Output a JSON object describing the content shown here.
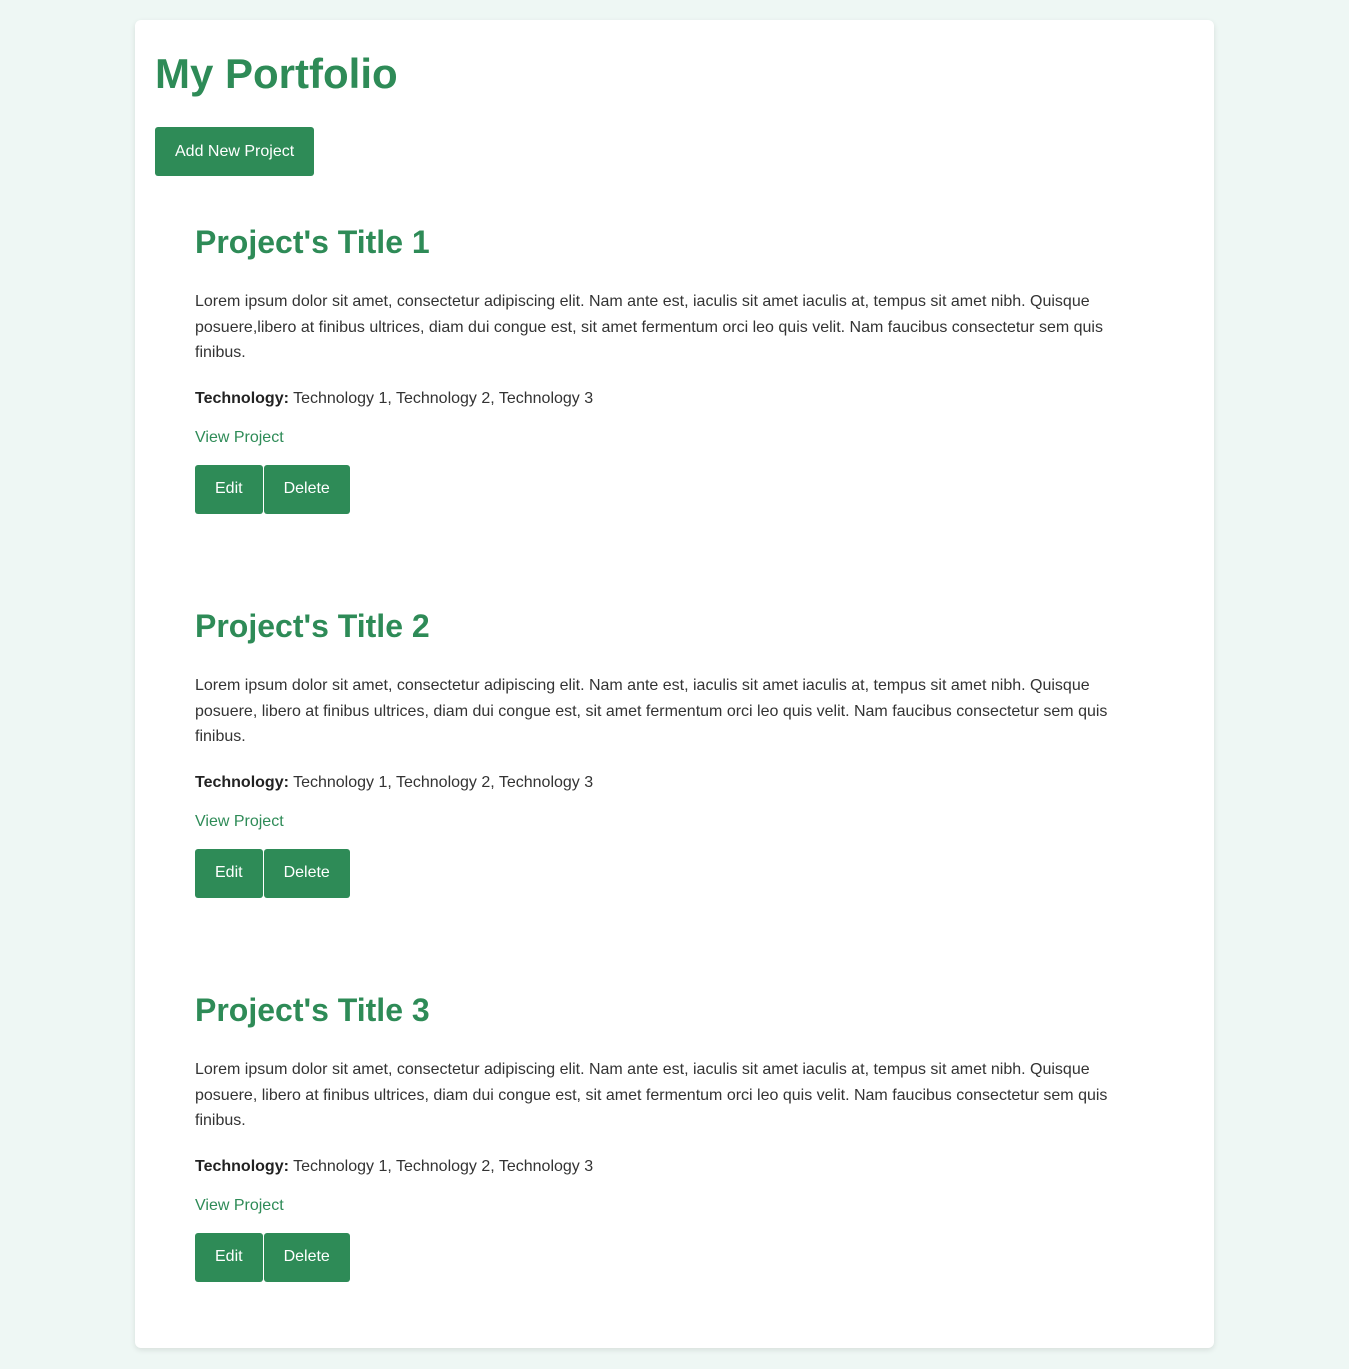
{
  "header": {
    "title": "My Portfolio",
    "add_button_label": "Add New Project"
  },
  "projects": [
    {
      "title": "Project's Title 1",
      "description": "Lorem ipsum dolor sit amet, consectetur adipiscing elit. Nam ante est, iaculis sit amet iaculis at, tempus sit amet nibh. Quisque posuere,libero at finibus ultrices, diam dui congue est, sit amet fermentum orci leo quis velit. Nam faucibus consectetur sem quis finibus.",
      "technology_label": "Technology:",
      "technologies": "Technology 1, Technology 2, Technology 3",
      "view_label": "View Project",
      "edit_label": "Edit",
      "delete_label": "Delete"
    },
    {
      "title": "Project's Title 2",
      "description": "Lorem ipsum dolor sit amet, consectetur adipiscing elit. Nam ante est, iaculis sit amet iaculis at, tempus sit amet nibh. Quisque posuere, libero at finibus ultrices, diam dui congue est, sit amet fermentum orci leo quis velit. Nam faucibus consectetur sem quis finibus.",
      "technology_label": "Technology:",
      "technologies": "Technology 1, Technology 2, Technology 3",
      "view_label": "View Project",
      "edit_label": "Edit",
      "delete_label": "Delete"
    },
    {
      "title": "Project's Title 3",
      "description": "Lorem ipsum dolor sit amet, consectetur adipiscing elit. Nam ante est, iaculis sit amet iaculis at, tempus sit amet nibh. Quisque posuere, libero at finibus ultrices, diam dui congue est, sit amet fermentum orci leo quis velit. Nam faucibus consectetur sem quis finibus.",
      "technology_label": "Technology:",
      "technologies": "Technology 1, Technology 2, Technology 3",
      "view_label": "View Project",
      "edit_label": "Edit",
      "delete_label": "Delete"
    }
  ],
  "colors": {
    "accent": "#2e8b57",
    "page_background": "#eef7f4",
    "card_background": "#ffffff",
    "text": "#333333"
  }
}
